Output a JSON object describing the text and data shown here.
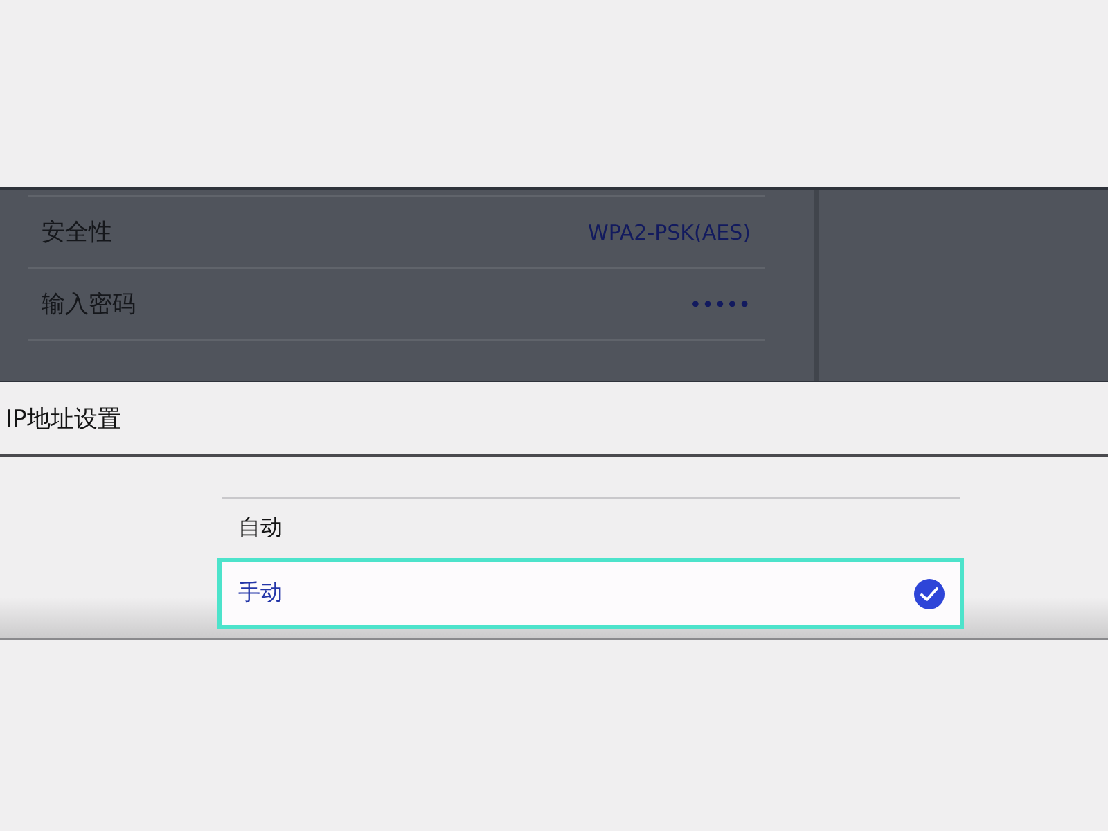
{
  "background_panel": {
    "rows": [
      {
        "label": "安全性",
        "value": "WPA2-PSK(AES)"
      },
      {
        "label": "输入密码",
        "value": "•••••"
      }
    ]
  },
  "dialog": {
    "title": "IP地址设置",
    "options": [
      {
        "label": "自动",
        "selected": false
      },
      {
        "label": "手动",
        "selected": true
      }
    ]
  }
}
